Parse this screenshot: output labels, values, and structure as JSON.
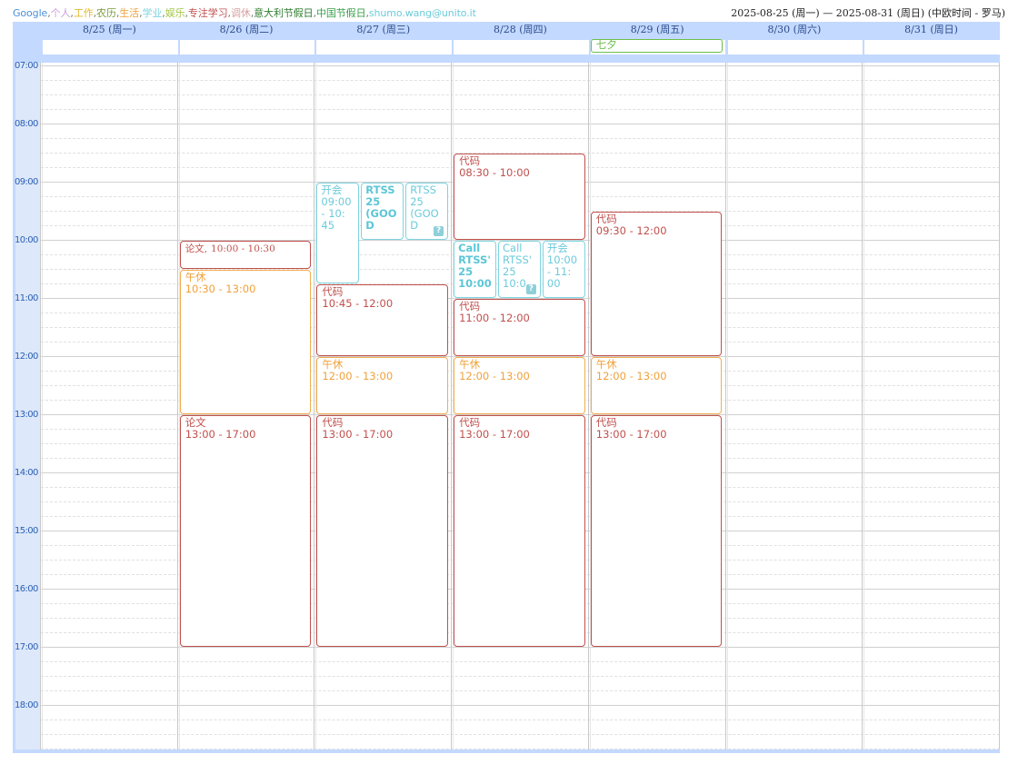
{
  "calendars": [
    {
      "label": "Google",
      "color": "#4a90d9"
    },
    {
      "label": ",",
      "color": "#777777"
    },
    {
      "label": "个人",
      "color": "#c9a0dc"
    },
    {
      "label": ",",
      "color": "#777777"
    },
    {
      "label": "工作",
      "color": "#e5b830"
    },
    {
      "label": ",",
      "color": "#777777"
    },
    {
      "label": "农历",
      "color": "#7a9a3a"
    },
    {
      "label": ",",
      "color": "#777777"
    },
    {
      "label": "生活",
      "color": "#f0a13a"
    },
    {
      "label": ",",
      "color": "#777777"
    },
    {
      "label": "学业",
      "color": "#7fd4e0"
    },
    {
      "label": ",",
      "color": "#777777"
    },
    {
      "label": "娱乐",
      "color": "#a5c84a"
    },
    {
      "label": ",",
      "color": "#777777"
    },
    {
      "label": "专注学习",
      "color": "#c0504d"
    },
    {
      "label": ",",
      "color": "#777777"
    },
    {
      "label": "调休",
      "color": "#d8a0a0"
    },
    {
      "label": ",",
      "color": "#777777"
    },
    {
      "label": "意大利节假日",
      "color": "#2f7d2f"
    },
    {
      "label": ",",
      "color": "#777777"
    },
    {
      "label": "中国节假日",
      "color": "#3aa04a"
    },
    {
      "label": ",",
      "color": "#777777"
    },
    {
      "label": "shumo.wang@unito.it",
      "color": "#6ccbda"
    }
  ],
  "date_range": "2025-08-25 (周一) — 2025-08-31 (周日) (中欧时间 - 罗马)",
  "days": [
    "8/25 (周一)",
    "8/26 (周二)",
    "8/27 (周三)",
    "8/28 (周四)",
    "8/29 (周五)",
    "8/30 (周六)",
    "8/31 (周日)"
  ],
  "allday_events": [
    {
      "day": 4,
      "title": "七夕",
      "color": "green"
    }
  ],
  "hours": [
    "07:00",
    "08:00",
    "09:00",
    "10:00",
    "11:00",
    "12:00",
    "13:00",
    "14:00",
    "15:00",
    "16:00",
    "17:00",
    "18:00"
  ],
  "events": [
    {
      "day": 1,
      "title": "论文,",
      "time": "10:00 - 10:30",
      "start": 10.0,
      "end": 10.5,
      "color": "red",
      "inline": true,
      "serif": true,
      "col": 0,
      "cols": 1
    },
    {
      "day": 1,
      "title": "午休",
      "time": "10:30 - 13:00",
      "start": 10.5,
      "end": 13.0,
      "color": "orange",
      "col": 0,
      "cols": 1
    },
    {
      "day": 1,
      "title": "论文",
      "time": "13:00 - 17:00",
      "start": 13.0,
      "end": 17.0,
      "color": "red",
      "col": 0,
      "cols": 1
    },
    {
      "day": 2,
      "title": "开会",
      "time": "09:00 - 10: 45",
      "start": 9.0,
      "end": 10.75,
      "color": "cyan",
      "col": 0,
      "cols": 3,
      "wrap": true
    },
    {
      "day": 2,
      "title": "RTSS 25 (GOO D",
      "time": "",
      "start": 9.0,
      "end": 10.0,
      "color": "cyan-strong",
      "col": 1,
      "cols": 3,
      "wrap": true
    },
    {
      "day": 2,
      "title": "RTSS 25 (GOO D",
      "time": "",
      "start": 9.0,
      "end": 10.0,
      "color": "cyan",
      "col": 2,
      "cols": 3,
      "wrap": true,
      "badge": "?"
    },
    {
      "day": 2,
      "title": "代码",
      "time": "10:45 - 12:00",
      "start": 10.75,
      "end": 12.0,
      "color": "red",
      "col": 0,
      "cols": 1
    },
    {
      "day": 2,
      "title": "午休",
      "time": "12:00 - 13:00",
      "start": 12.0,
      "end": 13.0,
      "color": "orange",
      "col": 0,
      "cols": 1
    },
    {
      "day": 2,
      "title": "代码",
      "time": "13:00 - 17:00",
      "start": 13.0,
      "end": 17.0,
      "color": "red",
      "col": 0,
      "cols": 1
    },
    {
      "day": 3,
      "title": "代码",
      "time": "08:30 - 10:00",
      "start": 8.5,
      "end": 10.0,
      "color": "red",
      "col": 0,
      "cols": 1
    },
    {
      "day": 3,
      "title": "Call RTSS' 25",
      "time": "10:00",
      "start": 10.0,
      "end": 11.0,
      "color": "cyan-strong",
      "col": 0,
      "cols": 3,
      "wrap": true
    },
    {
      "day": 3,
      "title": "Call RTSS' 25",
      "time": "10:0",
      "start": 10.0,
      "end": 11.0,
      "color": "cyan",
      "col": 1,
      "cols": 3,
      "wrap": true,
      "badge": "?"
    },
    {
      "day": 3,
      "title": "开会",
      "time": "10:00 - 11: 00",
      "start": 10.0,
      "end": 11.0,
      "color": "cyan",
      "col": 2,
      "cols": 3,
      "wrap": true
    },
    {
      "day": 3,
      "title": "代码",
      "time": "11:00 - 12:00",
      "start": 11.0,
      "end": 12.0,
      "color": "red",
      "col": 0,
      "cols": 1
    },
    {
      "day": 3,
      "title": "午休",
      "time": "12:00 - 13:00",
      "start": 12.0,
      "end": 13.0,
      "color": "orange",
      "col": 0,
      "cols": 1
    },
    {
      "day": 3,
      "title": "代码",
      "time": "13:00 - 17:00",
      "start": 13.0,
      "end": 17.0,
      "color": "red",
      "col": 0,
      "cols": 1
    },
    {
      "day": 4,
      "title": "代码",
      "time": "09:30 - 12:00",
      "start": 9.5,
      "end": 12.0,
      "color": "red",
      "col": 0,
      "cols": 1
    },
    {
      "day": 4,
      "title": "午休",
      "time": "12:00 - 13:00",
      "start": 12.0,
      "end": 13.0,
      "color": "orange",
      "col": 0,
      "cols": 1
    },
    {
      "day": 4,
      "title": "代码",
      "time": "13:00 - 17:00",
      "start": 13.0,
      "end": 17.0,
      "color": "red",
      "col": 0,
      "cols": 1
    }
  ]
}
